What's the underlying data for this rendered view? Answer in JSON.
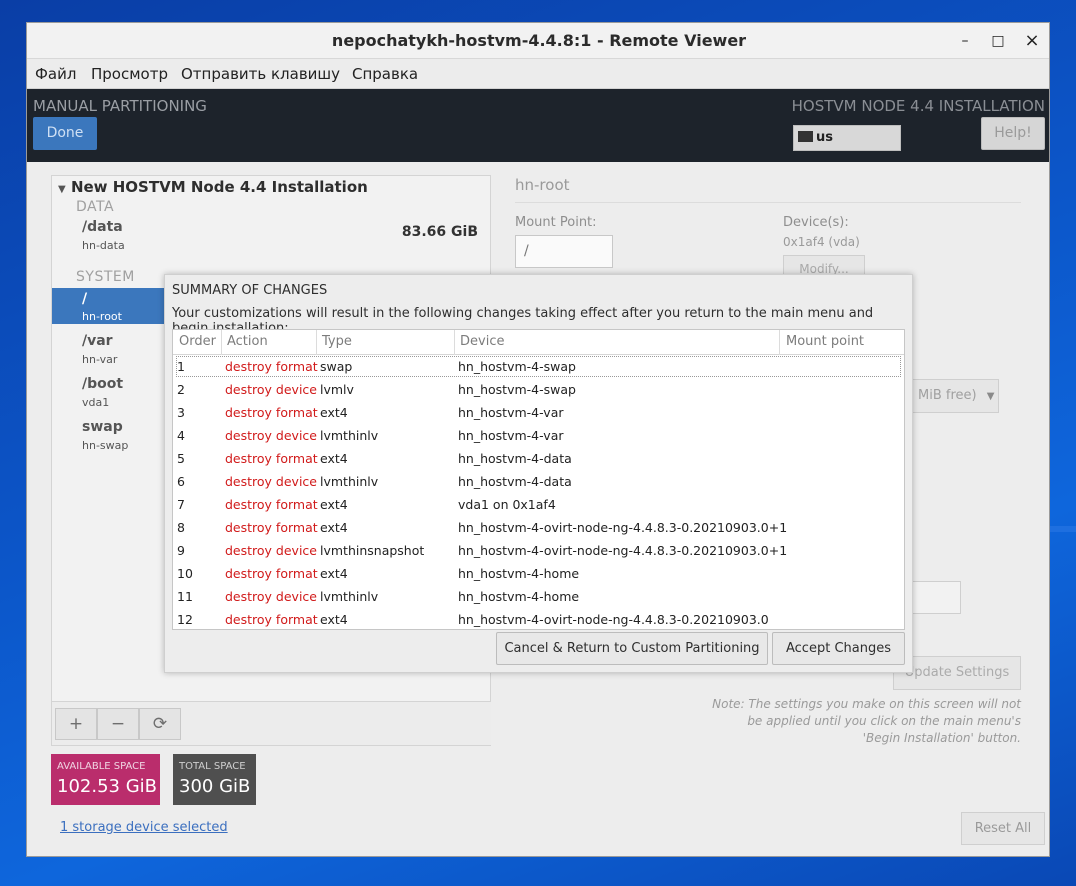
{
  "window": {
    "title": "nepochatykh-hostvm-4.4.8:1 - Remote Viewer",
    "minimize_glyph": "–",
    "maximize_glyph": "□",
    "close_glyph": "×"
  },
  "menubar": [
    "Файл",
    "Просмотр",
    "Отправить клавишу",
    "Справка"
  ],
  "header": {
    "spoke_title": "MANUAL PARTITIONING",
    "done_label": "Done",
    "product_title": "HOSTVM NODE 4.4 INSTALLATION",
    "keyboard_layout": "us",
    "help_label": "Help!"
  },
  "left_pane": {
    "installation_title": "New HOSTVM Node 4.4 Installation",
    "sections": {
      "data": "DATA",
      "system": "SYSTEM"
    },
    "mounts": [
      {
        "name": "/data",
        "device": "hn-data",
        "size": "83.66 GiB"
      },
      {
        "name": "/",
        "device": "hn-root"
      },
      {
        "name": "/var",
        "device": "hn-var"
      },
      {
        "name": "/boot",
        "device": "vda1"
      },
      {
        "name": "swap",
        "device": "hn-swap"
      }
    ],
    "tools": {
      "add": "+",
      "remove": "−",
      "refresh": "⟳"
    }
  },
  "space": {
    "available_label": "AVAILABLE SPACE",
    "available_value": "102.53 GiB",
    "total_label": "TOTAL SPACE",
    "total_value": "300 GiB",
    "storage_link": "1 storage device selected"
  },
  "right_pane": {
    "title": "hn-root",
    "mount_point_label": "Mount Point:",
    "mount_point_value": "/",
    "devices_label": "Device(s):",
    "devices_value": "0x1af4 (vda)",
    "modify_label": "Modify...",
    "vg_select_text": "MiB free)",
    "update_label": "Update Settings",
    "note": "Note:  The settings you make on this screen will not be applied until you click on the main menu's 'Begin Installation' button.",
    "reset_label": "Reset All"
  },
  "dialog": {
    "title": "SUMMARY OF CHANGES",
    "subtitle": "Your customizations will result in the following changes taking effect after you return to the main menu and begin installation:",
    "columns": [
      "Order",
      "Action",
      "Type",
      "Device",
      "Mount point"
    ],
    "rows": [
      {
        "order": "1",
        "action": "destroy format",
        "type": "swap",
        "device": "hn_hostvm-4-swap",
        "mount": ""
      },
      {
        "order": "2",
        "action": "destroy device",
        "type": "lvmlv",
        "device": "hn_hostvm-4-swap",
        "mount": ""
      },
      {
        "order": "3",
        "action": "destroy format",
        "type": "ext4",
        "device": "hn_hostvm-4-var",
        "mount": ""
      },
      {
        "order": "4",
        "action": "destroy device",
        "type": "lvmthinlv",
        "device": "hn_hostvm-4-var",
        "mount": ""
      },
      {
        "order": "5",
        "action": "destroy format",
        "type": "ext4",
        "device": "hn_hostvm-4-data",
        "mount": ""
      },
      {
        "order": "6",
        "action": "destroy device",
        "type": "lvmthinlv",
        "device": "hn_hostvm-4-data",
        "mount": ""
      },
      {
        "order": "7",
        "action": "destroy format",
        "type": "ext4",
        "device": "vda1 on 0x1af4",
        "mount": ""
      },
      {
        "order": "8",
        "action": "destroy format",
        "type": "ext4",
        "device": "hn_hostvm-4-ovirt-node-ng-4.4.8.3-0.20210903.0+1",
        "mount": ""
      },
      {
        "order": "9",
        "action": "destroy device",
        "type": "lvmthinsnapshot",
        "device": "hn_hostvm-4-ovirt-node-ng-4.4.8.3-0.20210903.0+1",
        "mount": ""
      },
      {
        "order": "10",
        "action": "destroy format",
        "type": "ext4",
        "device": "hn_hostvm-4-home",
        "mount": ""
      },
      {
        "order": "11",
        "action": "destroy device",
        "type": "lvmthinlv",
        "device": "hn_hostvm-4-home",
        "mount": ""
      },
      {
        "order": "12",
        "action": "destroy format",
        "type": "ext4",
        "device": "hn_hostvm-4-ovirt-node-ng-4.4.8.3-0.20210903.0",
        "mount": ""
      }
    ],
    "cancel_label": "Cancel & Return to Custom Partitioning",
    "accept_label": "Accept Changes"
  },
  "colors": {
    "action_red": "#d11a1a",
    "accent_blue": "#3b77bd",
    "available_pink": "#ba2d6c",
    "total_gray": "#4f4f4f"
  }
}
